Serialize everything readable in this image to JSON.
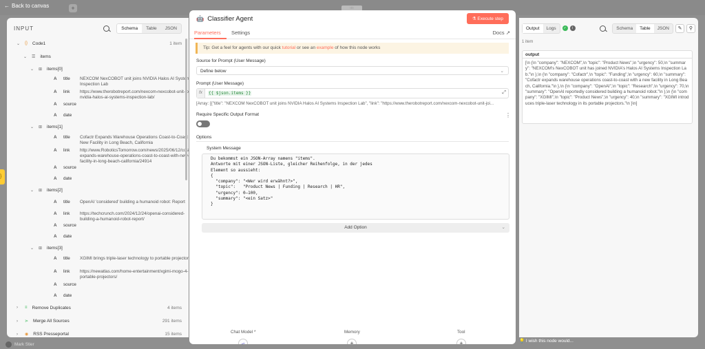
{
  "topbar": {
    "back_label": "Back to canvas",
    "pill": "::::"
  },
  "input_panel": {
    "title": "INPUT",
    "views": [
      "Schema",
      "Table",
      "JSON"
    ],
    "root": {
      "label": "Code1",
      "count": "1 item",
      "type": "{}"
    },
    "items_label": "items",
    "items": [
      {
        "label": "items[0]",
        "title": "NEXCOM NexCOBOT unit joins NVIDIA Halos AI Systems Inspection Lab",
        "link": "https://www.therobotreport.com/nexcom-nexcobot-unit-joins-nvidia-halos-ai-systems-inspection-lab/"
      },
      {
        "label": "items[1]",
        "title": "Cofactr Expands Warehouse Operations Coast-to-Coast with New Facility in Long Beach, California",
        "link": "http://www.RoboticsTomorrow.com/news/2025/06/12/cofactr-expands-warehouse-operations-coast-to-coast-with-new-facility-in-long-beach-california/24914"
      },
      {
        "label": "items[2]",
        "title": "OpenAI 'considered' building a humanoid robot: Report",
        "link": "https://techcrunch.com/2024/12/24/openai-considered-building-a-humanoid-robot-report/"
      },
      {
        "label": "items[3]",
        "title": "XGIMI brings triple-laser technology to portable projectors",
        "link": "https://newatlas.com/home-entertainment/xgimi-mogo-4-portable-projectors/"
      }
    ],
    "field_keys": {
      "title": "title",
      "link": "link",
      "source": "source",
      "date": "date"
    },
    "type_letter": "A",
    "nodes": [
      {
        "label": "Remove Duplicates",
        "count": "4 items"
      },
      {
        "label": "Merge All Sources",
        "count": "291 items"
      },
      {
        "label": "RSS Presseportal",
        "count": "15 items"
      }
    ]
  },
  "modal": {
    "title": "Classifier Agent",
    "execute_label": "Execute step",
    "tabs": [
      "Parameters",
      "Settings"
    ],
    "docs_label": "Docs",
    "tip": {
      "prefix": "Tip: Get a feel for agents with our quick ",
      "link1": "tutorial",
      "middle": " or see an ",
      "link2": "example",
      "suffix": " of how this node works"
    },
    "source_label": "Source for Prompt (User Message)",
    "source_value": "Define below",
    "prompt_label": "Prompt (User Message)",
    "prompt_expr": "{{ $json.items }}",
    "prompt_preview": "[Array: [{\"title\": \"NEXCOM NexCOBOT unit joins NVIDIA Halos AI Systems Inspection Lab\", \"link\": \"https://www.therobotreport.com/nexcom-nexcobot-unit-joi...",
    "format_label": "Require Specific Output Format",
    "options_label": "Options",
    "system_label": "System Message",
    "system_message": "Du bekommst ein JSON-Array namens \"items\".\nAntworte mit einer JSON-Liste, gleicher Reihenfolge, in der jedes\nElement so aussieht:\n{\n  \"company\": \"<Wer wird erwähnt?>\",\n  \"topic\":   \"Product News | Funding | Research | HR\",\n  \"urgency\": 0–100,\n  \"summary\": \"<ein Satz>\"\n}",
    "add_option_label": "Add Option",
    "connectors": [
      {
        "label": "Chat Model *"
      },
      {
        "label": "Memory"
      },
      {
        "label": "Tool"
      }
    ]
  },
  "output_panel": {
    "tabs": [
      "Output",
      "Logs"
    ],
    "views": [
      "Schema",
      "Table",
      "JSON"
    ],
    "count": "1 item",
    "field": "output",
    "value": "[\\n {\\n  \"company\": \"NEXCOM\",\\n  \"topic\": \"Product News\",\\n  \"urgency\": 50,\\n  \"summary\": \"NEXCOM's NexCOBOT unit has joined NVIDIA's Halos AI Systems Inspection Lab.\"\\n },\\n {\\n  \"company\": \"Cofactr\",\\n  \"topic\": \"Funding\",\\n  \"urgency\": 60,\\n  \"summary\": \"Cofactr expands warehouse operations coast-to-coast with a new facility in Long Beach, California.\"\\n },\\n {\\n  \"company\": \"OpenAI\",\\n  \"topic\": \"Research\",\\n  \"urgency\": 70,\\n  \"summary\": \"OpenAI reportedly considered building a humanoid robot.\"\\n },\\n {\\n  \"company\": \"XGIMI\",\\n  \"topic\": \"Product News\",\\n  \"urgency\": 40,\\n  \"summary\": \"XGIMI introduces triple-laser technology in its portable projectors.\"\\n }\\n]",
    "wish_label": "I wish this node would..."
  },
  "footer": {
    "user": "Mark Stier"
  }
}
